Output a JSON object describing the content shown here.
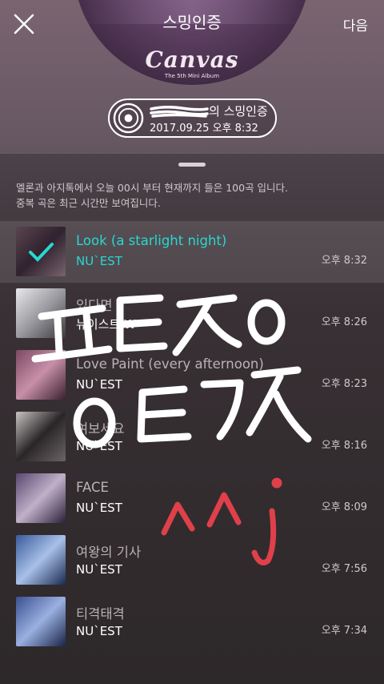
{
  "header": {
    "title": "스밍인증",
    "album_logo": "Canvas",
    "album_subtitle": "The 5th Mini Album",
    "next_label": "다음",
    "close_icon": "close-icon"
  },
  "certificate": {
    "label_suffix": "의 스밍인증",
    "datetime": "2017.09.25 오후 8:32",
    "icon": "disc-icon"
  },
  "notice": {
    "line1": "멜론과 아지톡에서 오늘 00시 부터 현재까지 들은 100곡 입니다.",
    "line2": "중복 곡은 최근 시간만 보여집니다."
  },
  "songs": [
    {
      "title": "Look (a starlight night)",
      "artist": "NU`EST",
      "time": "오후 8:32",
      "selected": true,
      "cover": [
        "#8a6a78",
        "#4a3548",
        "#b89aa8"
      ]
    },
    {
      "title": "있다면",
      "artist": "뉴이스트 W",
      "time": "오후 8:26",
      "selected": false,
      "cover": [
        "#e8e8ea",
        "#9a9aa0",
        "#3a3a3e"
      ]
    },
    {
      "title": "Love Paint (every afternoon)",
      "artist": "NU`EST",
      "time": "오후 8:23",
      "selected": false,
      "cover": [
        "#7a4a62",
        "#c890a8",
        "#3a2030"
      ]
    },
    {
      "title": "여보세요",
      "artist": "NU`EST",
      "time": "오후 8:16",
      "selected": false,
      "cover": [
        "#c8c4c2",
        "#2a2628",
        "#6a6466"
      ]
    },
    {
      "title": "FACE",
      "artist": "NU`EST",
      "time": "오후 8:09",
      "selected": false,
      "cover": [
        "#5a4870",
        "#c0b0c8",
        "#2a2038"
      ]
    },
    {
      "title": "여왕의 기사",
      "artist": "NU`EST",
      "time": "오후 7:56",
      "selected": false,
      "cover": [
        "#3a5a9a",
        "#a8c0e8",
        "#1a2a50"
      ]
    },
    {
      "title": "티격태격",
      "artist": "NU`EST",
      "time": "오후 7:34",
      "selected": false,
      "cover": [
        "#3a5090",
        "#9ab0e0",
        "#182448"
      ]
    }
  ],
  "colors": {
    "accent": "#28d8d0",
    "doodle_white": "#ffffff",
    "doodle_red": "#e0404a"
  }
}
